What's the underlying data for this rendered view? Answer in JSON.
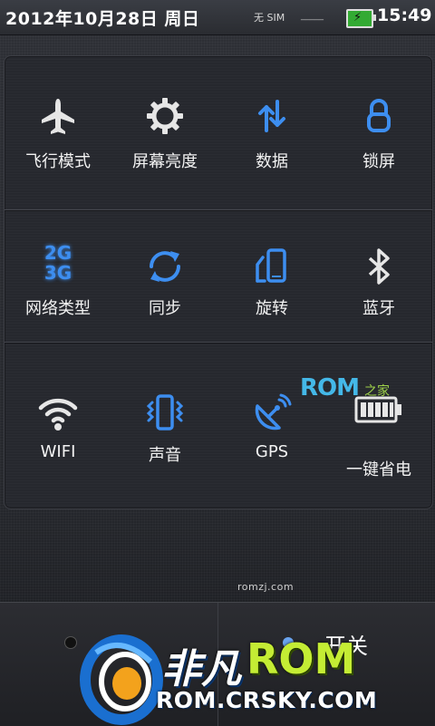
{
  "status_bar": {
    "date": "2012年10月28日 周日",
    "sim_status": "无 SIM",
    "sim_dashes": "_____",
    "battery_icon": "battery-charging-icon",
    "time": "15:49"
  },
  "toggles": [
    {
      "label": "飞行模式",
      "icon": "airplane-icon",
      "state": "off"
    },
    {
      "label": "屏幕亮度",
      "icon": "brightness-gear-icon",
      "state": "off"
    },
    {
      "label": "数据",
      "icon": "data-arrows-icon",
      "state": "on"
    },
    {
      "label": "锁屏",
      "icon": "lock-icon",
      "state": "on"
    },
    {
      "label": "网络类型",
      "icon": "network-2g3g-icon",
      "state": "on"
    },
    {
      "label": "同步",
      "icon": "sync-icon",
      "state": "on"
    },
    {
      "label": "旋转",
      "icon": "rotate-icon",
      "state": "on"
    },
    {
      "label": "蓝牙",
      "icon": "bluetooth-icon",
      "state": "off"
    },
    {
      "label": "WIFI",
      "icon": "wifi-icon",
      "state": "off"
    },
    {
      "label": "声音",
      "icon": "vibrate-phone-icon",
      "state": "on"
    },
    {
      "label": "GPS",
      "icon": "gps-satellite-icon",
      "state": "on"
    },
    {
      "label": "一键省电",
      "icon": "battery-saver-icon",
      "state": "off"
    }
  ],
  "network_icon_text": {
    "top": "2G",
    "bottom": "3G"
  },
  "watermarks": {
    "rom_brand": "ROM",
    "rom_brand_suffix": "之家",
    "url_small": "romzj.com"
  },
  "bottom_bar": {
    "switch_label": "开关"
  },
  "logo": {
    "name_cn": "非凡",
    "name_rom": "ROM",
    "url": "ROM.CRSKY.COM"
  },
  "colors": {
    "active_icon": "#3d8ef0",
    "inactive_icon": "#e6e6e6",
    "logo_green": "#c4ec34"
  }
}
